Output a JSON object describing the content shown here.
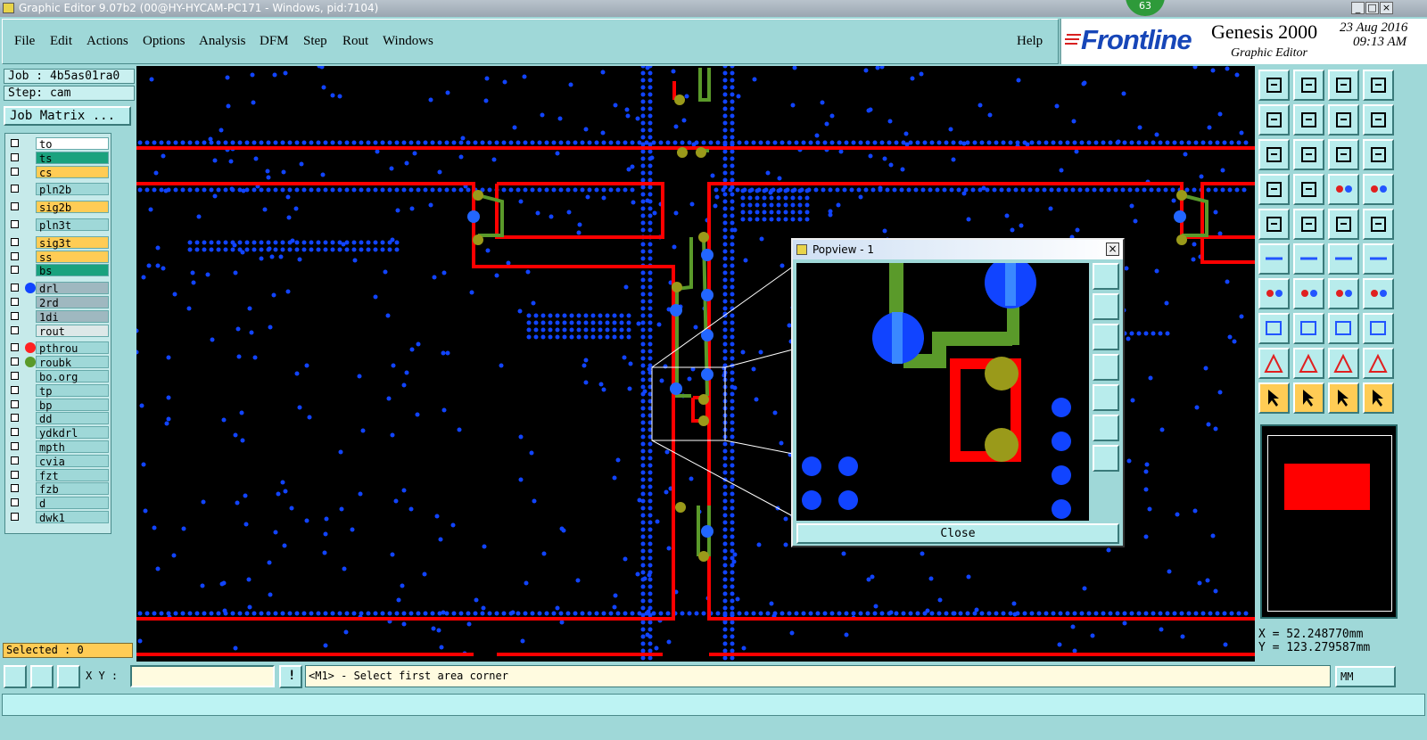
{
  "window": {
    "title": "Graphic Editor 9.07b2 (00@HY-HYCAM-PC171 - Windows, pid:7104)",
    "badge": "63"
  },
  "menu": {
    "items": [
      "File",
      "Edit",
      "Actions",
      "Options",
      "Analysis",
      "DFM",
      "Step",
      "Rout",
      "Windows"
    ],
    "help": "Help"
  },
  "brand": {
    "logo": "Frontline",
    "product": "Genesis 2000",
    "subtitle": "Graphic Editor",
    "date": "23 Aug 2016",
    "time": "09:13 AM"
  },
  "job": {
    "job_label": "Job : 4b5as01ra0",
    "step_label": "Step: cam",
    "matrix_button": "Job Matrix ..."
  },
  "layers": [
    {
      "name": "to",
      "color": "#ffffff",
      "dot": ""
    },
    {
      "name": "ts",
      "color": "#1aa27e",
      "dot": ""
    },
    {
      "name": "cs",
      "color": "#ffcc55",
      "dot": ""
    },
    {
      "name": "pln2b",
      "color": "#9fd8d8",
      "dot": ""
    },
    {
      "name": "sig2b",
      "color": "#ffcc55",
      "dot": ""
    },
    {
      "name": "pln3t",
      "color": "#9fd8d8",
      "dot": ""
    },
    {
      "name": "sig3t",
      "color": "#ffcc55",
      "dot": ""
    },
    {
      "name": "ss",
      "color": "#ffcc55",
      "dot": ""
    },
    {
      "name": "bs",
      "color": "#1aa27e",
      "dot": ""
    },
    {
      "name": "drl",
      "color": "#9fb8c0",
      "dot": "#1144ff"
    },
    {
      "name": "2rd",
      "color": "#9fb8c0",
      "dot": ""
    },
    {
      "name": "1di",
      "color": "#9fb8c0",
      "dot": ""
    },
    {
      "name": "rout",
      "color": "#dde8e8",
      "dot": ""
    },
    {
      "name": "pthrou",
      "color": "#9fd8d8",
      "dot": "#ff2222"
    },
    {
      "name": "roubk",
      "color": "#9fd8d8",
      "dot": "#5a9a2a"
    },
    {
      "name": "bo.org",
      "color": "#9fd8d8",
      "dot": ""
    },
    {
      "name": "tp",
      "color": "#9fd8d8",
      "dot": ""
    },
    {
      "name": "bp",
      "color": "#9fd8d8",
      "dot": ""
    },
    {
      "name": "dd",
      "color": "#9fd8d8",
      "dot": ""
    },
    {
      "name": "ydkdrl",
      "color": "#9fd8d8",
      "dot": ""
    },
    {
      "name": "mpth",
      "color": "#9fd8d8",
      "dot": ""
    },
    {
      "name": "cvia",
      "color": "#9fd8d8",
      "dot": ""
    },
    {
      "name": "fzt",
      "color": "#9fd8d8",
      "dot": ""
    },
    {
      "name": "fzb",
      "color": "#9fd8d8",
      "dot": ""
    },
    {
      "name": "d",
      "color": "#9fd8d8",
      "dot": ""
    },
    {
      "name": "dwk1",
      "color": "#9fd8d8",
      "dot": ""
    }
  ],
  "selected": "Selected : 0",
  "popview": {
    "title": "Popview - 1",
    "close_label": "Close"
  },
  "coords": {
    "x": "X = 52.248770mm",
    "y": "Y = 123.279587mm"
  },
  "command": {
    "xy_label": "X Y :",
    "xy_value": "",
    "prompt": "<M1> - Select first area corner",
    "units": "MM"
  },
  "colors": {
    "trace_red": "#ff0000",
    "trace_green": "#5a9a2a",
    "pad_blue": "#1144ff",
    "panel": "#9fd8d8"
  }
}
